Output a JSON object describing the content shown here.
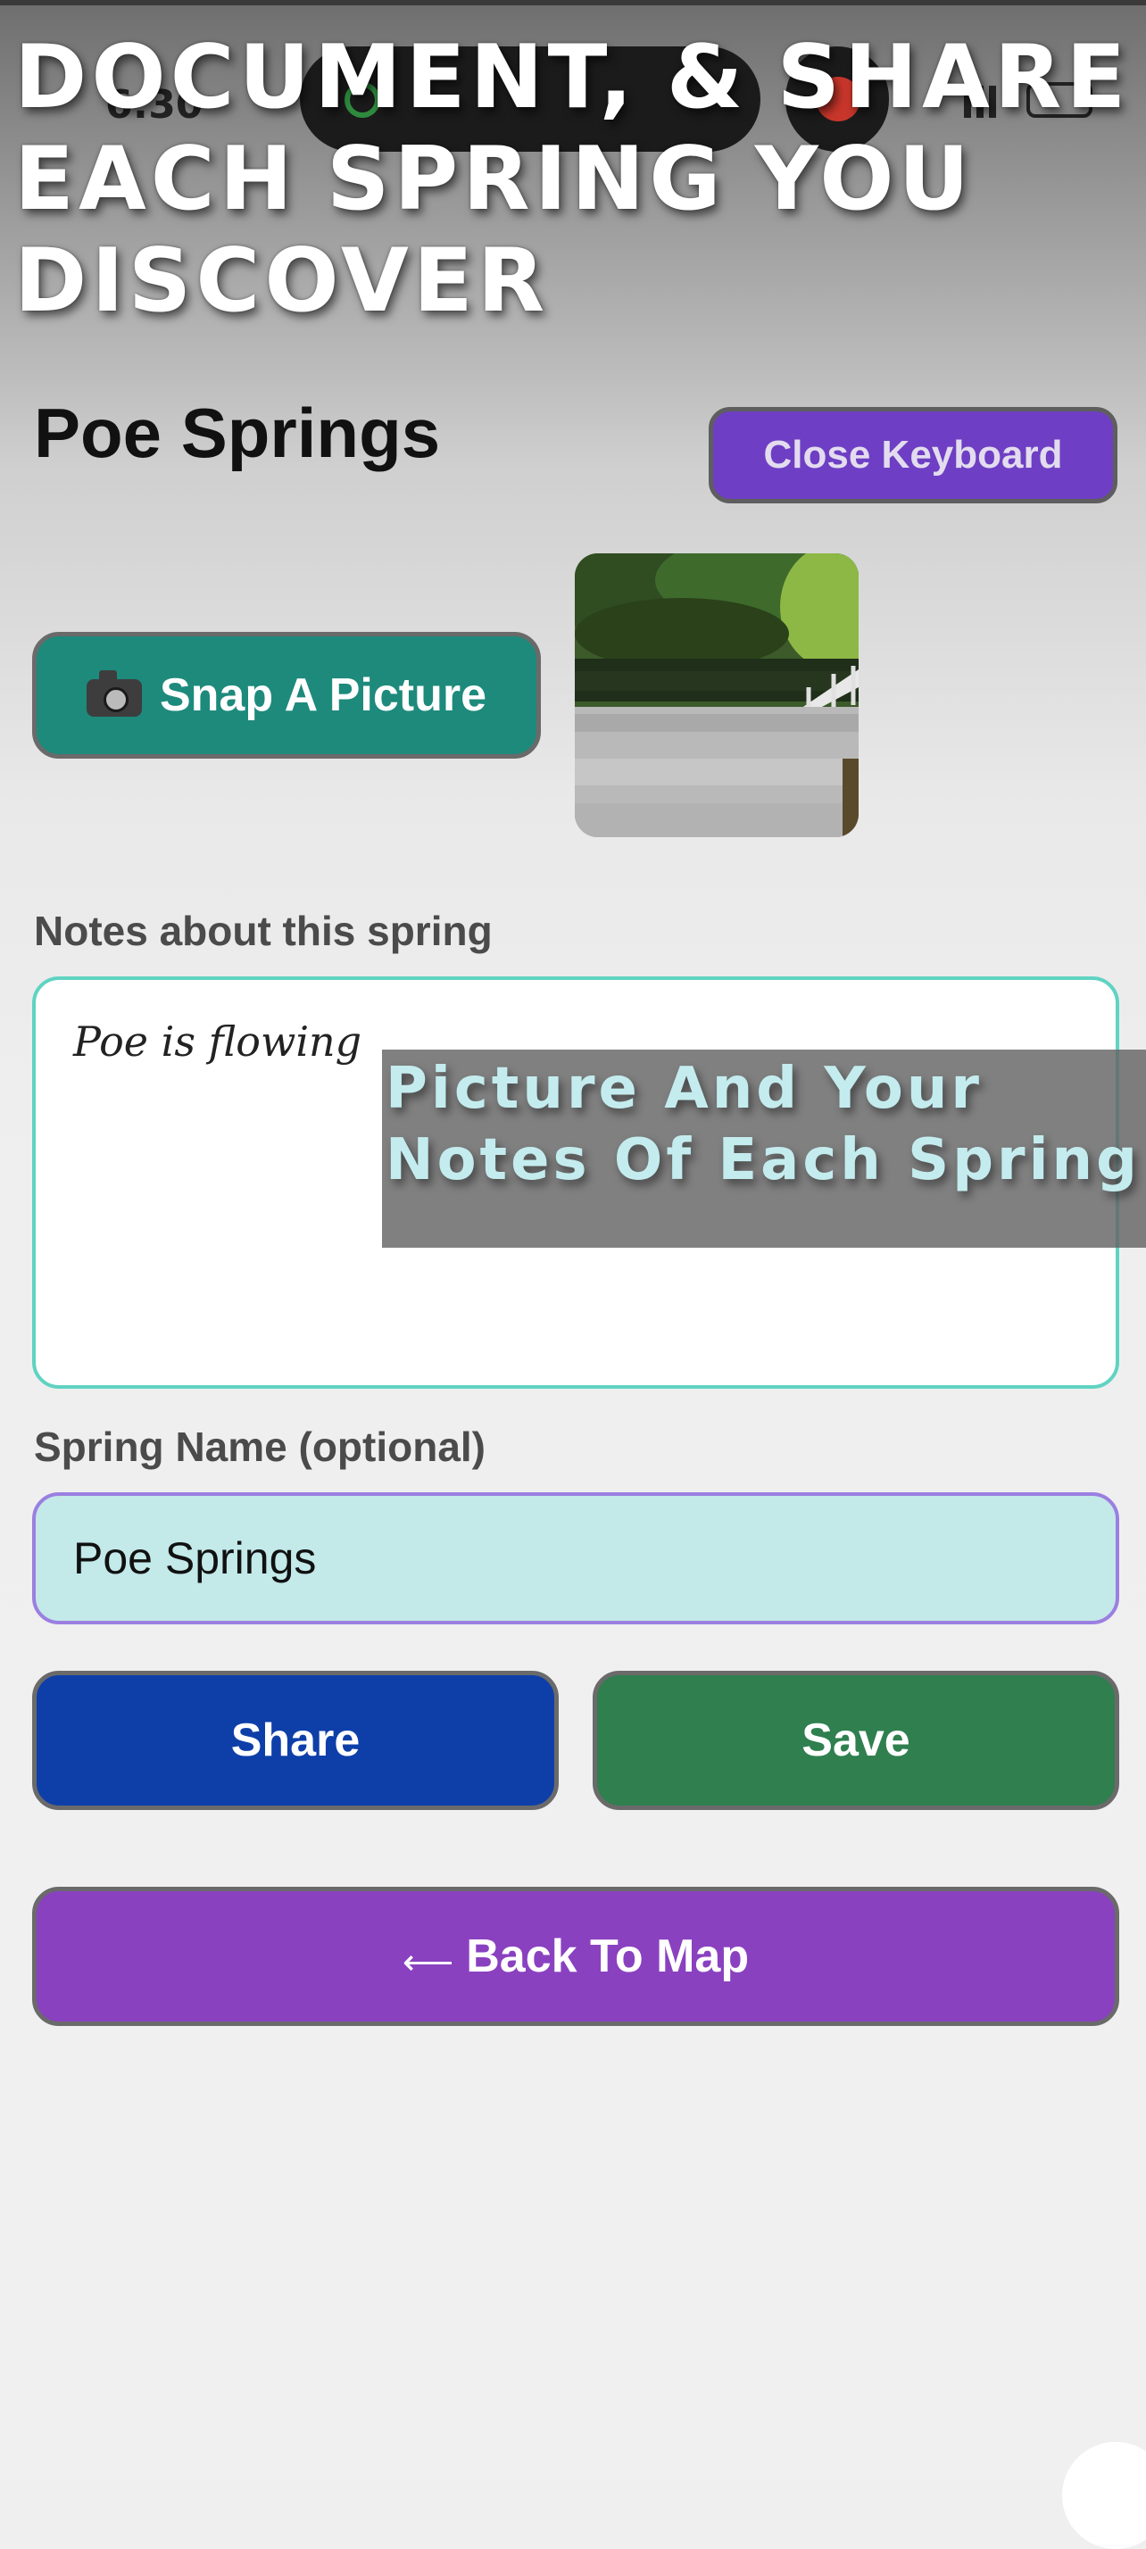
{
  "headline": "Document, & Share\nEach Spring You\nDiscover",
  "status_bar": {
    "time": "6:30"
  },
  "page_title": "Poe Springs",
  "close_keyboard_label": "Close Keyboard",
  "snap_picture_label": "Snap A Picture",
  "icons": {
    "camera": "camera-icon",
    "arrow": "arrow-left-icon"
  },
  "notes": {
    "label": "Notes about this spring",
    "value": "Poe is flowing"
  },
  "caption": "Picture And Your\nNotes Of Each Spring",
  "spring_name": {
    "label": "Spring Name (optional)",
    "value": "Poe Springs"
  },
  "buttons": {
    "share": "Share",
    "save": "Save",
    "back_arrow": "⟵",
    "back": "Back To Map"
  },
  "colors": {
    "close_keyboard": "#6e3fc4",
    "snap_picture": "#1d8a7c",
    "share": "#0e3fa9",
    "save": "#2f7f4f",
    "back": "#8a41c0",
    "notes_border": "#60d3c2",
    "name_field_bg": "#c3e9e9",
    "caption_text": "#c4ecef"
  }
}
